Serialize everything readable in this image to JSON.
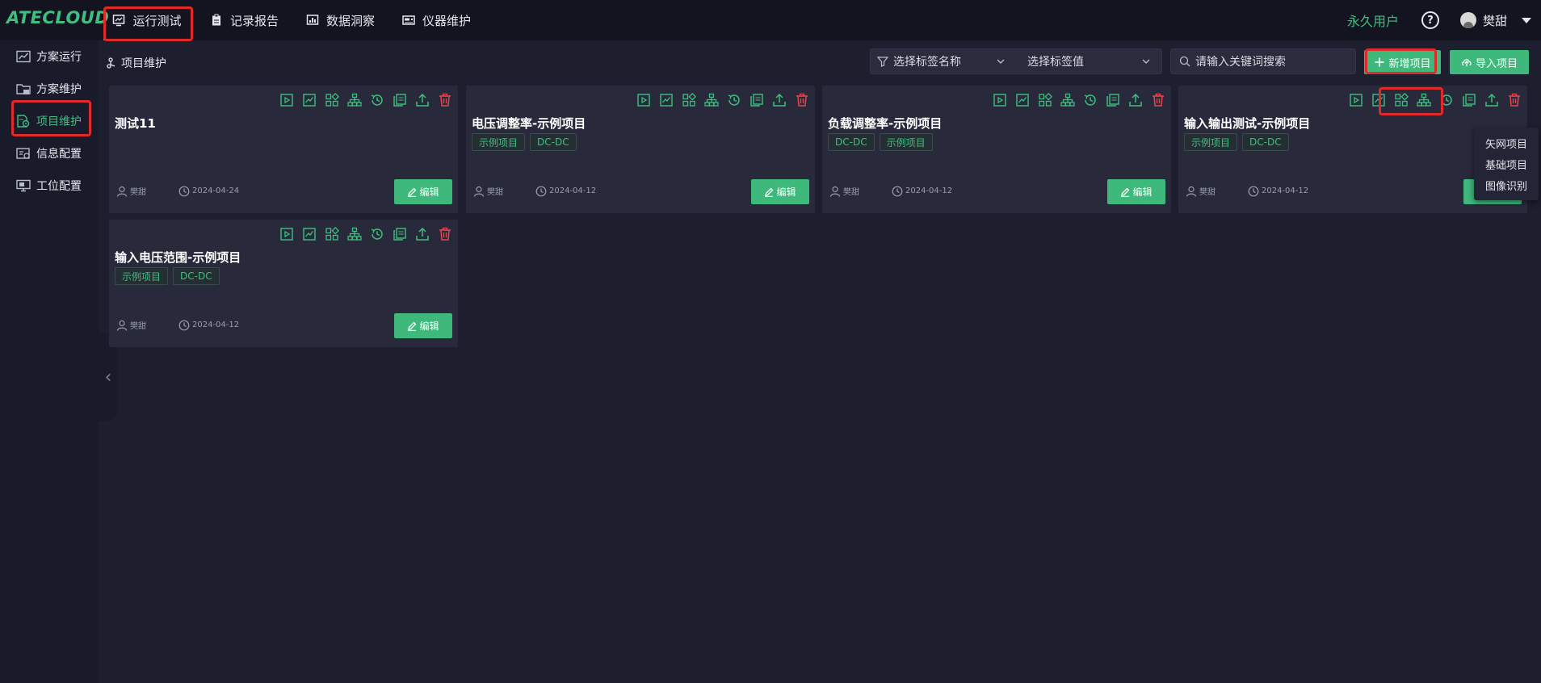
{
  "app": {
    "logo": "ATECLOUD"
  },
  "topnav": [
    {
      "label": "运行测试",
      "icon": "monitor-chart-icon",
      "active": true
    },
    {
      "label": "记录报告",
      "icon": "clipboard-icon"
    },
    {
      "label": "数据洞察",
      "icon": "bar-chart-icon"
    },
    {
      "label": "仪器维护",
      "icon": "instrument-icon"
    }
  ],
  "user": {
    "plan": "永久用户",
    "help": "?",
    "name": "樊甜"
  },
  "sidebar": [
    {
      "label": "方案运行",
      "icon": "chart-window-icon"
    },
    {
      "label": "方案维护",
      "icon": "folder-icon"
    },
    {
      "label": "项目维护",
      "icon": "document-gear-icon",
      "active": true
    },
    {
      "label": "信息配置",
      "icon": "id-card-icon"
    },
    {
      "label": "工位配置",
      "icon": "workstation-icon"
    }
  ],
  "breadcrumb": {
    "label": "项目维护"
  },
  "filters": {
    "tag_name_placeholder": "选择标签名称",
    "tag_value_placeholder": "选择标签值",
    "search_placeholder": "请输入关键词搜索"
  },
  "buttons": {
    "new_project": "新增项目",
    "import_project": "导入项目",
    "edit": "编辑"
  },
  "new_project_menu": [
    "矢网项目",
    "基础项目",
    "图像识别"
  ],
  "cards": [
    {
      "title": "测试11",
      "tags": [],
      "user": "樊甜",
      "date": "2024-04-24"
    },
    {
      "title": "电压调整率-示例项目",
      "tags": [
        "示例项目",
        "DC-DC"
      ],
      "user": "樊甜",
      "date": "2024-04-12"
    },
    {
      "title": "负载调整率-示例项目",
      "tags": [
        "DC-DC",
        "示例项目"
      ],
      "user": "樊甜",
      "date": "2024-04-12"
    },
    {
      "title": "输入输出测试-示例项目",
      "tags": [
        "示例项目",
        "DC-DC"
      ],
      "user": "樊甜",
      "date": "2024-04-12"
    },
    {
      "title": "输入电压范围-示例项目",
      "tags": [
        "示例项目",
        "DC-DC"
      ],
      "user": "樊甜",
      "date": "2024-04-12"
    }
  ],
  "colors": {
    "accent": "#3fbf7f",
    "danger": "#e8454f",
    "highlight": "#e02a2a"
  }
}
